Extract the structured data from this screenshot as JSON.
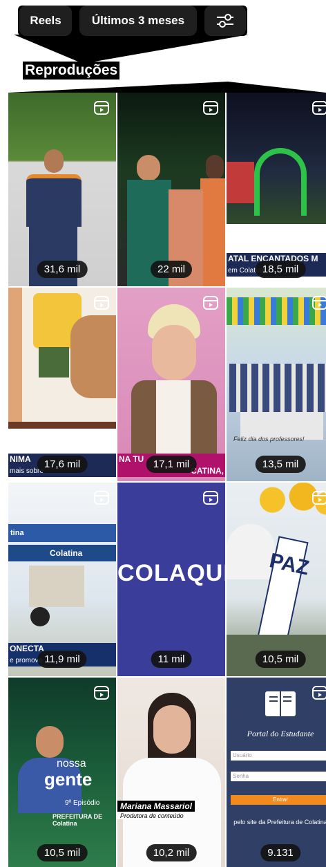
{
  "filters": {
    "reels_label": "Reels",
    "period_label": "Últimos 3 meses",
    "filter_icon": "sliders-icon"
  },
  "section": {
    "title": "Reproduções"
  },
  "tiles": [
    {
      "views": "31,6 mil"
    },
    {
      "views": "22 mil"
    },
    {
      "views": "18,5 mil",
      "banner_top": "ATAL ENCANTADOS M",
      "banner_bottom": "em Colatina"
    },
    {
      "views": "17,6 mil",
      "banner_top": "NIMA",
      "banner_bottom": "mais sobre"
    },
    {
      "views": "17,1 mil",
      "banner_top": "NA TU",
      "banner_bottom": "CATINA,"
    },
    {
      "views": "13,5 mil",
      "caption": "Feliz dia dos professores!"
    },
    {
      "views": "11,9 mil",
      "banner_top": "ONECTA",
      "banner_bottom": "e promove",
      "sign_top": "tina",
      "sign_main": "Colatina"
    },
    {
      "views": "11 mil",
      "logo": "COLAQUI"
    },
    {
      "views": "10,5 mil",
      "sign": "PAZ"
    },
    {
      "views": "10,5 mil",
      "logo1": "nossa",
      "logo2": "gente",
      "episode": "9º Episódio",
      "footer": "PREFEITURA DE Colatina"
    },
    {
      "views": "10,2 mil",
      "name": "Mariana Massariol",
      "role": "Produtora de conteúdo"
    },
    {
      "views": "9.131",
      "portal": "Portal do Estudante",
      "field1": "Usuário",
      "field2": "Senha",
      "button": "Entrar",
      "link": "pelo site da Prefeitura de Colatina"
    }
  ],
  "colors": {
    "reel_icon": "#ffffff",
    "badge_bg": "#141414"
  }
}
